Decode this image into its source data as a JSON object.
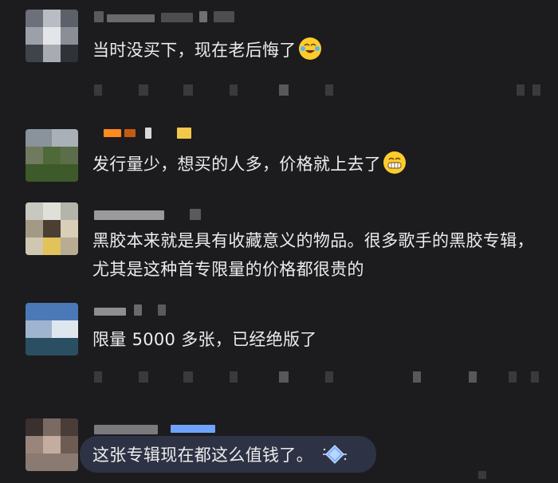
{
  "comments": [
    {
      "text": "当时没买下，现在老后悔了",
      "emoji": "crying-laughing"
    },
    {
      "text": "发行量少，想买的人多，价格就上去了",
      "emoji": "grinning"
    },
    {
      "text": "黑胶本来就是具有收藏意义的物品。很多歌手的黑胶专辑，尤其是这种首专限量的价格都很贵的",
      "emoji": ""
    },
    {
      "text": "限量 5000 多张，已经绝版了",
      "emoji": ""
    },
    {
      "text": "这张专辑现在都这么值钱了。",
      "emoji": ""
    }
  ],
  "colors": {
    "background": "#1c1c1e",
    "text": "#ececec",
    "highlight_bubble": "#2e3245",
    "badge_blue": "#6fa3ff",
    "badge_orange": "#ff8a1f"
  },
  "icons": [
    "crying-laughing-emoji",
    "grinning-emoji",
    "diamond-badge-icon"
  ]
}
